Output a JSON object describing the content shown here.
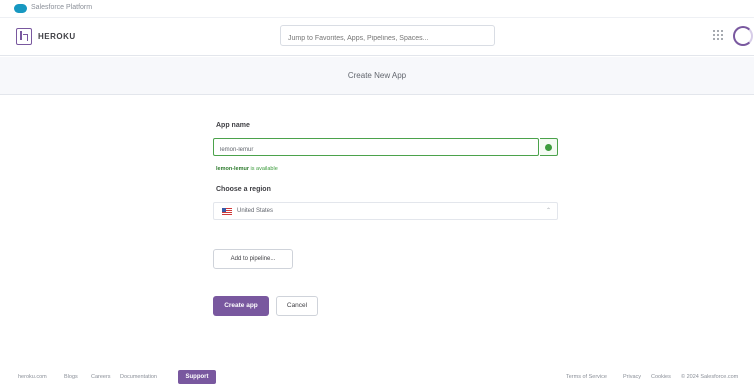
{
  "salesforce_bar": {
    "text": "Salesforce Platform"
  },
  "header": {
    "brand": "HEROKU",
    "search_placeholder": "Jump to Favorites, Apps, Pipelines, Spaces..."
  },
  "page": {
    "title": "Create New App"
  },
  "form": {
    "app_name_label": "App name",
    "app_name_value": "lemon-lemur",
    "availability_name": "lemon-lemur",
    "availability_suffix": " is available",
    "region_label": "Choose a region",
    "region_value": "United States",
    "add_pipeline_label": "Add to pipeline...",
    "create_label": "Create app",
    "cancel_label": "Cancel"
  },
  "footer": {
    "left_links": [
      "heroku.com",
      "Blogs",
      "Careers",
      "Documentation"
    ],
    "support_label": "Support",
    "right_links": [
      "Terms of Service",
      "Privacy",
      "Cookies",
      "© 2024 Salesforce.com"
    ]
  },
  "colors": {
    "brand_purple": "#79589f",
    "success_green": "#3d9c3d",
    "salesforce_blue": "#1798c1"
  }
}
